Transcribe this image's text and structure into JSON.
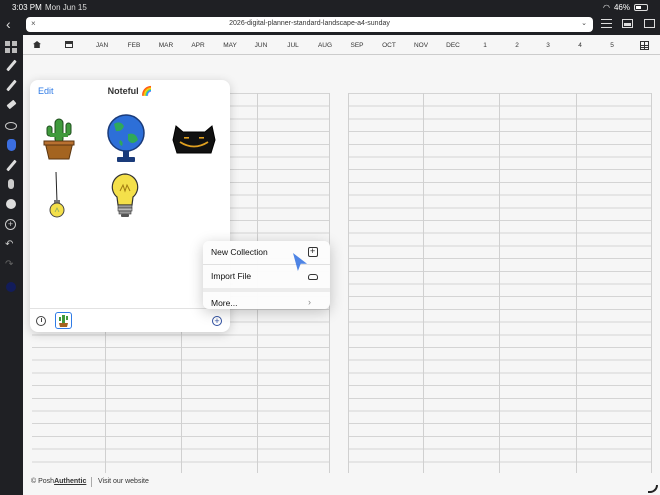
{
  "status": {
    "time": "3:03 PM",
    "date": "Mon Jun 15",
    "battery": "46%"
  },
  "document": {
    "title": "2026-digital-planner-standard-landscape-a4-sunday"
  },
  "nav": {
    "months": [
      "JAN",
      "FEB",
      "MAR",
      "APR",
      "MAY",
      "JUN",
      "JUL",
      "AUG",
      "SEP",
      "OCT",
      "NOV",
      "DEC"
    ],
    "numbers": [
      "1",
      "2",
      "3",
      "4",
      "5"
    ]
  },
  "panel": {
    "edit_label": "Edit",
    "title": "Noteful 🌈"
  },
  "menu": {
    "new_collection": "New Collection",
    "import_file": "Import File",
    "more": "More..."
  },
  "footer": {
    "copyright": "© Posh",
    "brand": "Authentic",
    "website": "Visit our website"
  },
  "colors": {
    "accent": "#2f7be6",
    "active_tool": "#3b6ee0",
    "selected_ink": "#121c5a"
  }
}
